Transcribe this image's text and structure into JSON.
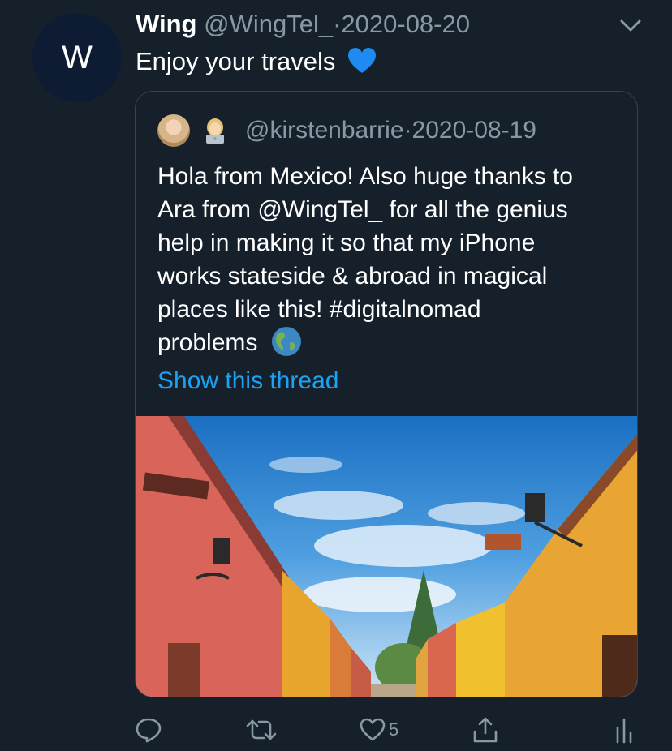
{
  "tweet": {
    "author_initial": "W",
    "author_name": "Wing",
    "author_handle": "@WingTel_",
    "separator": "·",
    "date": "2020-08-20",
    "text": "Enjoy your travels",
    "text_emoji": "blue-heart-icon"
  },
  "quoted": {
    "handle": "@kirstenbarrie",
    "separator": "·",
    "date": "2020-08-19",
    "text_lines": [
      "Hola from Mexico! Also huge thanks to",
      "Ara from @WingTel_ for all the genius",
      "help in making it so that my iPhone",
      "works stateside & abroad in magical",
      "places like this! #digitalnomad",
      "problems"
    ],
    "trailing_emoji": "globe-americas-icon",
    "show_thread": "Show this thread"
  },
  "actions": {
    "like_count": "5"
  },
  "colors": {
    "background": "#15202b",
    "secondary_text": "#8899a6",
    "link": "#1da1f2",
    "border": "#38444d"
  }
}
